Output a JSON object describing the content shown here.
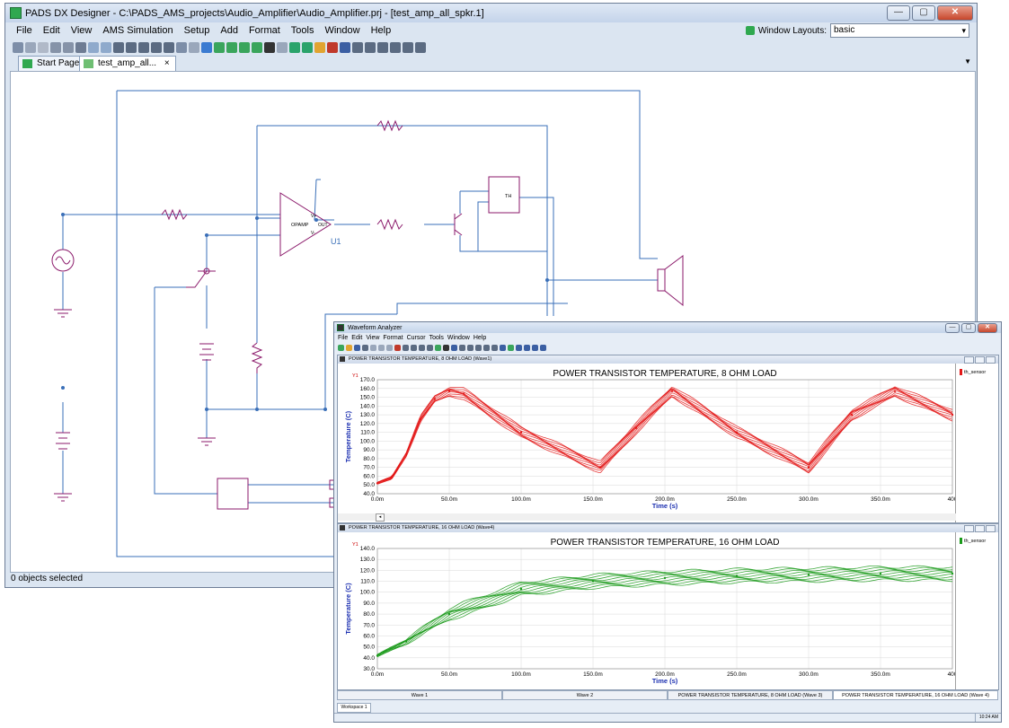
{
  "main": {
    "title": "PADS DX Designer - C:\\PADS_AMS_projects\\Audio_Amplifier\\Audio_Amplifier.prj - [test_amp_all_spkr.1]",
    "menu": [
      "File",
      "Edit",
      "View",
      "AMS Simulation",
      "Setup",
      "Add",
      "Format",
      "Tools",
      "Window",
      "Help"
    ],
    "window_layouts_label": "Window Layouts:",
    "window_layouts_value": "basic",
    "tabs": [
      {
        "label": "Start Page"
      },
      {
        "label": "test_amp_all..."
      }
    ],
    "tab_close": "×",
    "status": "0 objects selected",
    "schematic": {
      "opamp_label": "OPAMP",
      "opamp_pin_out": "OUT",
      "opamp_pin_vplus": "V+",
      "opamp_pin_vminus": "V-",
      "opamp_ref": "U1",
      "sensor_label": "TH"
    }
  },
  "wave": {
    "title": "Waveform Analyzer",
    "menu": [
      "File",
      "Edit",
      "View",
      "Format",
      "Cursor",
      "Tools",
      "Window",
      "Help"
    ],
    "panels": [
      {
        "header": "POWER TRANSISTOR TEMPERATURE, 8 OHM LOAD (Wave1)",
        "legend": "th_sensor",
        "legend_color": "#e31818",
        "marker": "Y1"
      },
      {
        "header": "POWER TRANSISTOR TEMPERATURE, 16 OHM LOAD (Wave4)",
        "legend": "th_sensor",
        "legend_color": "#1a9a1a",
        "marker": "Y1"
      }
    ],
    "bottom_tabs": [
      "Wave 1",
      "Wave 2",
      "POWER TRANSISTOR TEMPERATURE, 8 OHM LOAD (Wave 3)",
      "POWER TRANSISTOR TEMPERATURE, 16 OHM LOAD (Wave 4)"
    ],
    "workspace": "Workspace 1",
    "clock": "10:24 AM"
  },
  "chart_data": [
    {
      "type": "line",
      "title": "POWER TRANSISTOR TEMPERATURE, 8 OHM LOAD",
      "xlabel": "Time (s)",
      "ylabel": "Temperature (C)",
      "xlim": [
        0,
        0.4
      ],
      "ylim": [
        40,
        170
      ],
      "x_ticks": [
        "0.0m",
        "50.0m",
        "100.0m",
        "150.0m",
        "200.0m",
        "250.0m",
        "300.0m",
        "350.0m",
        "400"
      ],
      "y_ticks": [
        "40.0",
        "50.0",
        "60.0",
        "70.0",
        "80.0",
        "90.0",
        "100.0",
        "110.0",
        "120.0",
        "130.0",
        "140.0",
        "150.0",
        "160.0",
        "170.0"
      ],
      "grid": true,
      "color": "#e31818",
      "series": [
        {
          "name": "th_sensor",
          "x": [
            0,
            0.01,
            0.02,
            0.03,
            0.04,
            0.05,
            0.06,
            0.1,
            0.155,
            0.18,
            0.205,
            0.25,
            0.3,
            0.33,
            0.36,
            0.4
          ],
          "y": [
            52,
            58,
            85,
            125,
            148,
            157,
            154,
            110,
            70,
            115,
            157,
            110,
            70,
            130,
            157,
            130
          ]
        }
      ]
    },
    {
      "type": "line",
      "title": "POWER TRANSISTOR TEMPERATURE, 16 OHM LOAD",
      "xlabel": "Time (s)",
      "ylabel": "Temperature (C)",
      "xlim": [
        0,
        0.4
      ],
      "ylim": [
        30,
        140
      ],
      "x_ticks": [
        "0.0m",
        "50.0m",
        "100.0m",
        "150.0m",
        "200.0m",
        "250.0m",
        "300.0m",
        "350.0m",
        "400"
      ],
      "y_ticks": [
        "30.0",
        "40.0",
        "50.0",
        "60.0",
        "70.0",
        "80.0",
        "90.0",
        "100.0",
        "110.0",
        "120.0",
        "130.0",
        "140.0"
      ],
      "grid": true,
      "color": "#1a9a1a",
      "series": [
        {
          "name": "th_sensor",
          "x": [
            0,
            0.02,
            0.05,
            0.1,
            0.15,
            0.2,
            0.25,
            0.3,
            0.35,
            0.4
          ],
          "y": [
            42,
            55,
            80,
            103,
            110,
            113,
            115,
            116,
            117,
            117
          ]
        }
      ]
    }
  ]
}
